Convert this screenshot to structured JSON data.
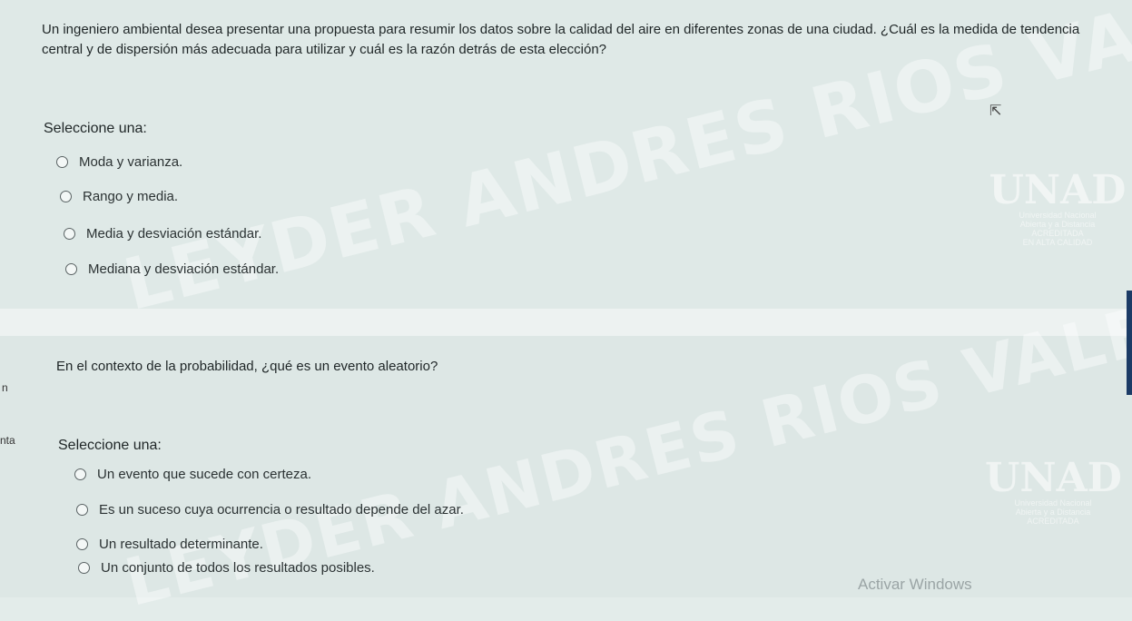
{
  "question1": {
    "text": "Un ingeniero ambiental desea presentar una propuesta para resumir los datos sobre la calidad del aire en diferentes zonas de una ciudad. ¿Cuál es la medida de tendencia central y de dispersión más adecuada para utilizar y cuál es la razón detrás de esta elección?",
    "select_label": "Seleccione una:",
    "options": [
      "Moda y varianza.",
      "Rango y media.",
      "Media y desviación estándar.",
      "Mediana y desviación estándar."
    ]
  },
  "question2": {
    "text": "En el contexto de la probabilidad, ¿qué es un evento aleatorio?",
    "select_label": "Seleccione una:",
    "options": [
      "Un evento que sucede con certeza.",
      "Es un suceso cuya ocurrencia o resultado depende del azar.",
      "Un resultado determinante.",
      "Un conjunto de todos los resultados posibles."
    ]
  },
  "side_fragments": {
    "frag1": "n",
    "frag2": "nta"
  },
  "watermark": {
    "line1": "LEYDER ANDRES RIOS VALENCIA",
    "line2": "LEYDER ANDRES RIOS VALENCIA"
  },
  "logo": {
    "mark": "UNAD",
    "sub1": "Universidad Nacional",
    "sub2": "Abierta y a Distancia",
    "sub3": "ACREDITADA",
    "sub4": "EN ALTA CALIDAD"
  },
  "activate_windows": "Activar Windows",
  "colors": {
    "background": "#e3ecea",
    "text": "#1f2627",
    "radio_border": "#5a6364"
  }
}
